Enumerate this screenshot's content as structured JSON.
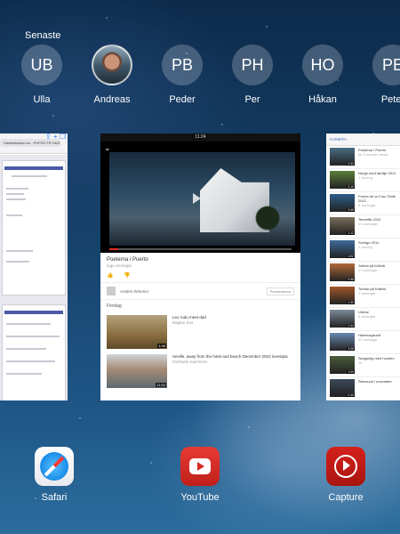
{
  "recent": {
    "label": "Senaste",
    "contacts": [
      {
        "initials": "UB",
        "name": "Ulla",
        "photo": false
      },
      {
        "initials": "",
        "name": "Andreas",
        "photo": true
      },
      {
        "initials": "PB",
        "name": "Peder",
        "photo": false
      },
      {
        "initials": "PH",
        "name": "Per",
        "photo": false
      },
      {
        "initials": "HO",
        "name": "Håkan",
        "photo": false
      },
      {
        "initials": "PE",
        "name": "Peter",
        "photo": false
      }
    ]
  },
  "safari_card": {
    "url": "Hastiktiksidan.se - PHPSD FR HAS..."
  },
  "youtube_card": {
    "status": "11:24",
    "progress": 0.05,
    "video_title": "Poeterna i Puerto",
    "views": "Inga visningar",
    "channel": "Anders Wimmer",
    "subscribe": "Prenumerera",
    "next_label": "Förslag",
    "recommendations": [
      {
        "title": "Leo rudu meet dad",
        "sub": "Bagtan Zoo",
        "duration": "1:48"
      },
      {
        "title": "Seville, away from the hotel and beach December 2010 lovestpia",
        "sub": "Gerhardt Joachinss",
        "duration": "11:52"
      }
    ]
  },
  "capture_card": {
    "header": "KAMERA",
    "items": [
      {
        "title": "Poeterna i Puerto",
        "sub": "för 5 minuter sedan",
        "duration": "0:32"
      },
      {
        "title": "Norge med familje 2011",
        "sub": "1 visning",
        "duration": "2:10"
      },
      {
        "title": "Puerto de la Cruz-Teide 2012",
        "sub": "6 visningar",
        "duration": "3:45"
      },
      {
        "title": "Teneriffa 2012",
        "sub": "23 visningar",
        "duration": "1:12"
      },
      {
        "title": "Sverige 2011",
        "sub": "1 visning",
        "duration": "4:02"
      },
      {
        "title": "Julfest på Kräfvik",
        "sub": "17 visningar",
        "duration": "0:58"
      },
      {
        "title": "Tomtar på Kräfvik",
        "sub": "2 visningar",
        "duration": "1:30"
      },
      {
        "title": "Umbai",
        "sub": "5 visningar",
        "duration": "2:44"
      },
      {
        "title": "Hamburgsund",
        "sub": "42 visningar",
        "duration": "3:05"
      },
      {
        "title": "Skogsstig med hunden",
        "sub": "14",
        "duration": "1:00"
      },
      {
        "title": "Stensund i november",
        "sub": "",
        "duration": "0:40"
      }
    ]
  },
  "dock": {
    "apps": [
      {
        "name": "Safari"
      },
      {
        "name": "YouTube"
      },
      {
        "name": "Capture"
      }
    ]
  }
}
